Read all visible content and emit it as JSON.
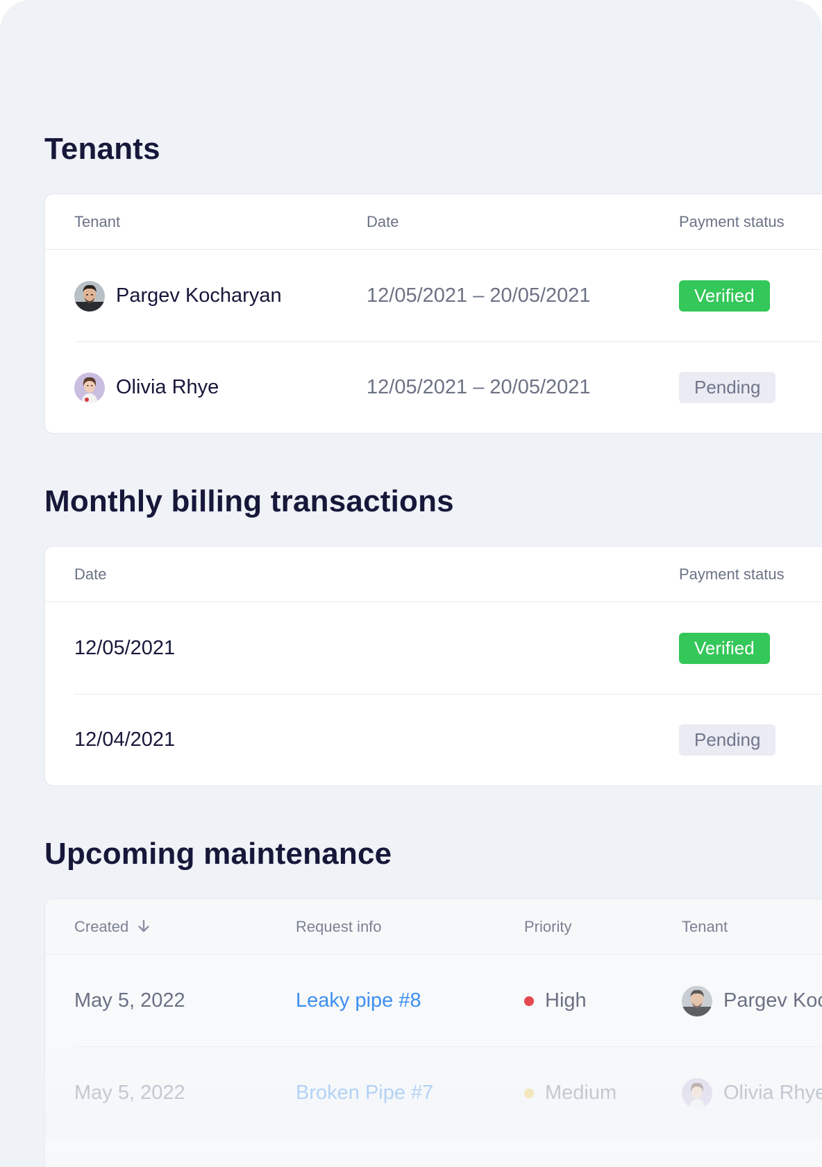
{
  "tenants": {
    "title": "Tenants",
    "columns": {
      "tenant": "Tenant",
      "date": "Date",
      "payment_status": "Payment status"
    },
    "rows": [
      {
        "name": "Pargev Kocharyan",
        "date_range": "12/05/2021 – 20/05/2021",
        "status": "Verified",
        "avatar_icon": "avatar-man-icon"
      },
      {
        "name": "Olivia Rhye",
        "date_range": "12/05/2021 – 20/05/2021",
        "status": "Pending",
        "avatar_icon": "avatar-woman-icon"
      }
    ]
  },
  "billing": {
    "title": "Monthly billing transactions",
    "columns": {
      "date": "Date",
      "payment_status": "Payment status"
    },
    "rows": [
      {
        "date": "12/05/2021",
        "status": "Verified"
      },
      {
        "date": "12/04/2021",
        "status": "Pending"
      }
    ]
  },
  "maintenance": {
    "title": "Upcoming maintenance",
    "columns": {
      "created": "Created",
      "request_info": "Request info",
      "priority": "Priority",
      "tenant": "Tenant"
    },
    "sort_icon": "arrow-down-icon",
    "rows": [
      {
        "created": "May 5, 2022",
        "request": "Leaky pipe #8",
        "priority": "High",
        "priority_color": "#e5484d",
        "tenant": "Pargev Koc"
      },
      {
        "created": "May 5, 2022",
        "request": "Broken Pipe #7",
        "priority": "Medium",
        "priority_color": "#f2c94c",
        "tenant": "Olivia Rhye"
      }
    ]
  },
  "colors": {
    "background": "#eff2f6",
    "heading": "#17173a",
    "verified": "#34c759",
    "pending_bg": "#eaebf3",
    "link": "#3d8ff0"
  }
}
